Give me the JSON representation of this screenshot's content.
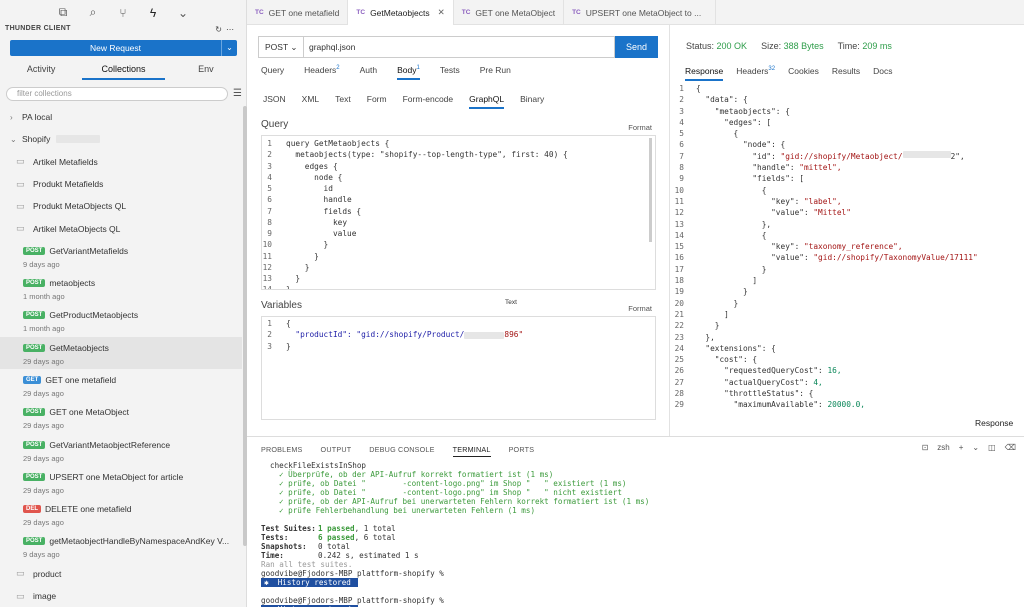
{
  "sidebar": {
    "brand": "THUNDER CLIENT",
    "new_request": "New Request",
    "tabs": [
      "Activity",
      "Collections",
      "Env"
    ],
    "filter_placeholder": "filter collections",
    "collections": [
      {
        "name": "PA local",
        "expanded": false
      },
      {
        "name": "Shopify",
        "expanded": true
      }
    ],
    "folders": [
      "Artikel Metafields",
      "Produkt Metafields",
      "Produkt MetaObjects QL",
      "Artikel MetaObjects QL"
    ],
    "requests": [
      {
        "method": "POST",
        "name": "GetVariantMetafields",
        "time": "9 days ago"
      },
      {
        "method": "POST",
        "name": "metaobjects",
        "time": "1 month ago"
      },
      {
        "method": "POST",
        "name": "GetProductMetaobjects",
        "time": "1 month ago"
      },
      {
        "method": "POST",
        "name": "GetMetaobjects",
        "time": "29 days ago"
      },
      {
        "method": "GET",
        "name": "GET one metafield",
        "time": "29 days ago"
      },
      {
        "method": "POST",
        "name": "GET one MetaObject",
        "time": "29 days ago"
      },
      {
        "method": "POST",
        "name": "GetVariantMetaobjectReference",
        "time": "29 days ago"
      },
      {
        "method": "POST",
        "name": "UPSERT one MetaObject for article",
        "time": "29 days ago"
      },
      {
        "method": "DEL",
        "name": "DELETE one metafield",
        "time": "29 days ago"
      },
      {
        "method": "POST",
        "name": "getMetaobjectHandleByNamespaceAndKey V...",
        "time": "9 days ago"
      }
    ],
    "bottom_folders": [
      "product",
      "image"
    ]
  },
  "editor_tabs": [
    {
      "code": "TC",
      "label": "GET one metafield"
    },
    {
      "code": "TC",
      "label": "GetMetaobjects"
    },
    {
      "code": "TC",
      "label": "GET one MetaObject"
    },
    {
      "code": "TC",
      "label": "UPSERT one MetaObject to ..."
    }
  ],
  "request": {
    "method": "POST",
    "url": "graphql.json",
    "send": "Send",
    "tabs": [
      "Query",
      "Headers",
      "Auth",
      "Body",
      "Tests",
      "Pre Run"
    ],
    "headers_count": "2",
    "body_count": "1",
    "body_tabs": [
      "JSON",
      "XML",
      "Text",
      "Form",
      "Form-encode",
      "GraphQL",
      "Binary"
    ],
    "query_label": "Query",
    "format_label": "Format",
    "variables_label": "Variables",
    "text_label": "Text",
    "query_lines": [
      "query GetMetaobjects {",
      "  metaobjects(type: \"shopify--top-length-type\", first: 40) {",
      "    edges {",
      "      node {",
      "        id",
      "        handle",
      "        fields {",
      "          key",
      "          value",
      "        }",
      "      }",
      "    }",
      "  }",
      "}"
    ],
    "variable_lines": [
      "{",
      "  \"productId\": \"gid://shopify/Product/",
      "}"
    ],
    "variable_suffix": "896\""
  },
  "response": {
    "status_label": "Status:",
    "status": "200 OK",
    "size_label": "Size:",
    "size": "388 Bytes",
    "time_label": "Time:",
    "time": "209 ms",
    "tabs": [
      "Response",
      "Headers",
      "Cookies",
      "Results",
      "Docs"
    ],
    "headers_count": "32",
    "button": "Response",
    "lines": [
      "{",
      "  \"data\": {",
      "    \"metaobjects\": {",
      "      \"edges\": [",
      "        {",
      "          \"node\": {",
      "            \"id\": \"gid://shopify/Metaobject/",
      "            \"handle\": \"mittel\",",
      "            \"fields\": [",
      "              {",
      "                \"key\": \"label\",",
      "                \"value\": \"Mittel\"",
      "              },",
      "              {",
      "                \"key\": \"taxonomy_reference\",",
      "                \"value\": \"gid://shopify/TaxonomyValue/17111\"",
      "              }",
      "            ]",
      "          }",
      "        }",
      "      ]",
      "    }",
      "  },",
      "  \"extensions\": {",
      "    \"cost\": {",
      "      \"requestedQueryCost\": 16,",
      "      \"actualQueryCost\": 4,",
      "      \"throttleStatus\": {",
      "        \"maximumAvailable\": 20000.0,"
    ],
    "id_suffix": "2\","
  },
  "terminal": {
    "tabs": [
      "PROBLEMS",
      "OUTPUT",
      "DEBUG CONSOLE",
      "TERMINAL",
      "PORTS"
    ],
    "shell": "zsh",
    "suite_name": "checkFileExistsInShop",
    "checks": [
      "✓ Überprüfe, ob der API-Aufruf korrekt formatiert ist (1 ms)",
      "✓ prüfe, ob Datei \"        -content-logo.png\" im Shop \"   \" existiert (1 ms)",
      "✓ prüfe, ob Datei \"        -content-logo.png\" im Shop \"   \" nicht existiert",
      "✓ prüfe, ob der API-Aufruf bei unerwarteten Fehlern korrekt formatiert ist (1 ms)",
      "✓ prüfe Fehlerbehandlung bei unerwarteten Fehlern (1 ms)"
    ],
    "summary": [
      {
        "label": "Test Suites:",
        "value": "1 passed",
        "rest": ", 1 total"
      },
      {
        "label": "Tests:",
        "value": "6 passed",
        "rest": ", 6 total"
      },
      {
        "label": "Snapshots:",
        "value": "",
        "rest": "0 total"
      },
      {
        "label": "Time:",
        "value": "",
        "rest": "0.242 s, estimated 1 s"
      }
    ],
    "ran": "Ran all test suites.",
    "prompt": "goodvibe@Fjodors-MBP plattform-shopify %",
    "history": "History restored"
  }
}
